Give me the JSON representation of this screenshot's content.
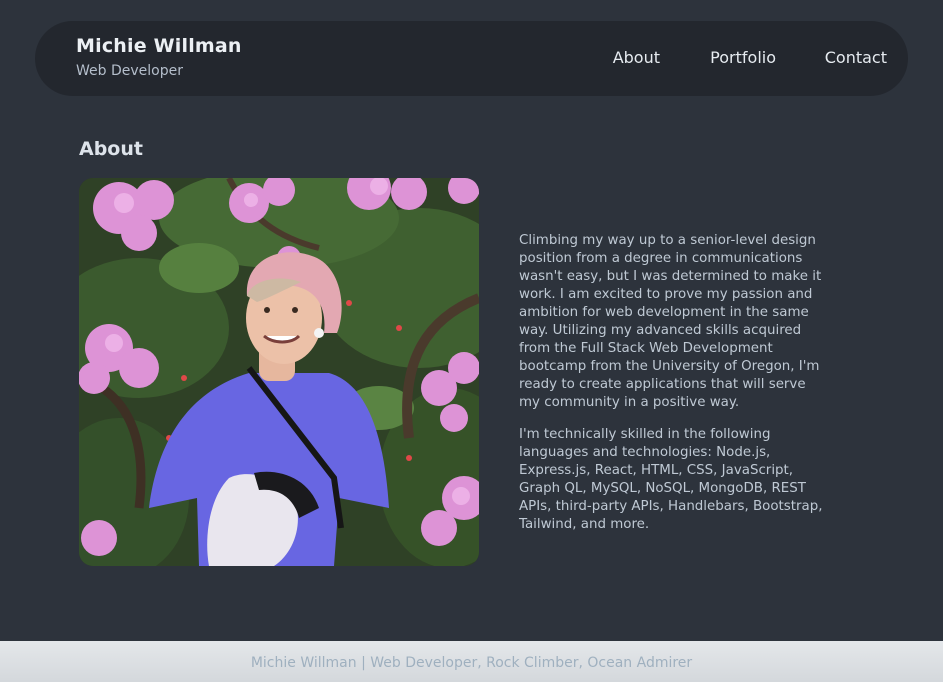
{
  "header": {
    "name": "Michie Willman",
    "title": "Web Developer",
    "nav": [
      {
        "label": "About"
      },
      {
        "label": "Portfolio"
      },
      {
        "label": "Contact"
      }
    ]
  },
  "about": {
    "heading": "About",
    "photo_alt": "Portrait of Michie Willman among pink flowers",
    "paragraphs": [
      "Climbing my way up to a senior-level design position from a degree in communications wasn't easy, but I was determined to make it work. I am excited to prove my passion and ambition for web development in the same way. Utilizing my advanced skills acquired from the Full Stack Web Development bootcamp from the University of Oregon, I'm ready to create applications that will serve my community in a positive way.",
      "I'm technically skilled in the following languages and technologies: Node.js, Express.js, React, HTML, CSS, JavaScript, Graph QL, MySQL, NoSQL, MongoDB, REST APIs, third-party APIs, Handlebars, Bootstrap, Tailwind, and more."
    ]
  },
  "footer": {
    "text": "Michie Willman | Web Developer, Rock Climber, Ocean Admirer"
  },
  "colors": {
    "background": "#2d333c",
    "header_bg": "#23272e",
    "footer_bg": "#e0e3e6",
    "accent_flower": "#d98fd0",
    "shirt": "#6a68e6"
  }
}
